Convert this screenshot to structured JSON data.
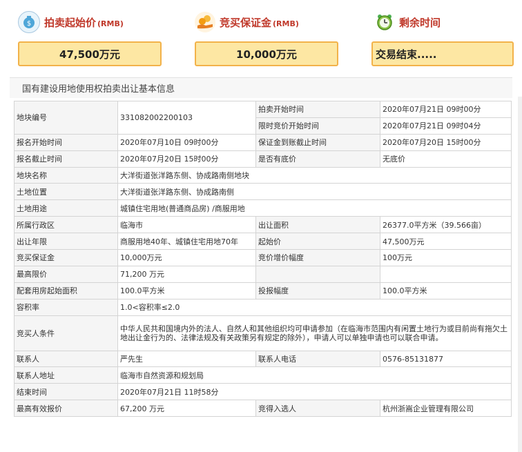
{
  "header": {
    "start_price": {
      "title": "拍卖起始价",
      "unit": "(RMB)",
      "value": "47,500万元",
      "icon": "money-bag-icon"
    },
    "deposit": {
      "title": "竞买保证金",
      "unit": "(RMB)",
      "value": "10,000万元",
      "icon": "coin-hand-icon"
    },
    "remaining": {
      "title": "剩余时间",
      "value": "交易结束.....",
      "icon": "alarm-clock-icon"
    }
  },
  "section": {
    "title": "国有建设用地使用权拍卖出让基本信息"
  },
  "labels": {
    "plot_no": "地块编号",
    "auction_start": "拍卖开始时间",
    "limit_start": "限时竞价开始时间",
    "reg_start": "报名开始时间",
    "deposit_deadline": "保证金到账截止时间",
    "reg_end": "报名截止时间",
    "reserve": "是否有底价",
    "plot_name": "地块名称",
    "location": "土地位置",
    "usage": "土地用途",
    "district": "所属行政区",
    "area": "出让面积",
    "term": "出让年限",
    "start_price": "起始价",
    "deposit": "竞买保证金",
    "increment": "竞价增价幅度",
    "max_price": "最高限价",
    "housing_start": "配套用房起始面积",
    "housing_step": "投报幅度",
    "far": "容积率",
    "bidder_cond": "竞买人条件",
    "contact": "联系人",
    "contact_phone": "联系人电话",
    "contact_addr": "联系人地址",
    "end_time": "结束时间",
    "top_price": "最高有效报价",
    "winner": "竞得入选人"
  },
  "values": {
    "plot_no": "331082002200103",
    "auction_start": "2020年07月21日 09时00分",
    "limit_start": "2020年07月21日 09时04分",
    "reg_start": "2020年07月10日 09时00分",
    "deposit_deadline": "2020年07月20日 15时00分",
    "reg_end": "2020年07月20日 15时00分",
    "reserve": "无底价",
    "plot_name": "大洋街道张洋路东侧、协成路南侧地块",
    "location": "大洋街道张洋路东侧、协成路南侧",
    "usage": "城镇住宅用地(普通商品房) /商服用地",
    "district": "临海市",
    "area": "26377.0平方米（39.566亩）",
    "term": "商服用地40年、城镇住宅用地70年",
    "start_price": "47,500万元",
    "deposit": "10,000万元",
    "increment": "100万元",
    "max_price": "71,200 万元",
    "housing_start": "100.0平方米",
    "housing_step": "100.0平方米",
    "far": "1.0<容积率≤2.0",
    "bidder_cond": "中华人民共和国境内外的法人、自然人和其他组织均可申请参加（在临海市范围内有闲置土地行为或目前尚有拖欠土地出让金行为的、法律法规及有关政策另有规定的除外），申请人可以单独申请也可以联合申请。",
    "contact": "严先生",
    "contact_phone": "0576-85131877",
    "contact_addr": "临海市自然资源和规划局",
    "end_time": "2020年07月21日 11时58分",
    "top_price": "67,200 万元",
    "winner": "杭州浙嵩企业管理有限公司"
  }
}
